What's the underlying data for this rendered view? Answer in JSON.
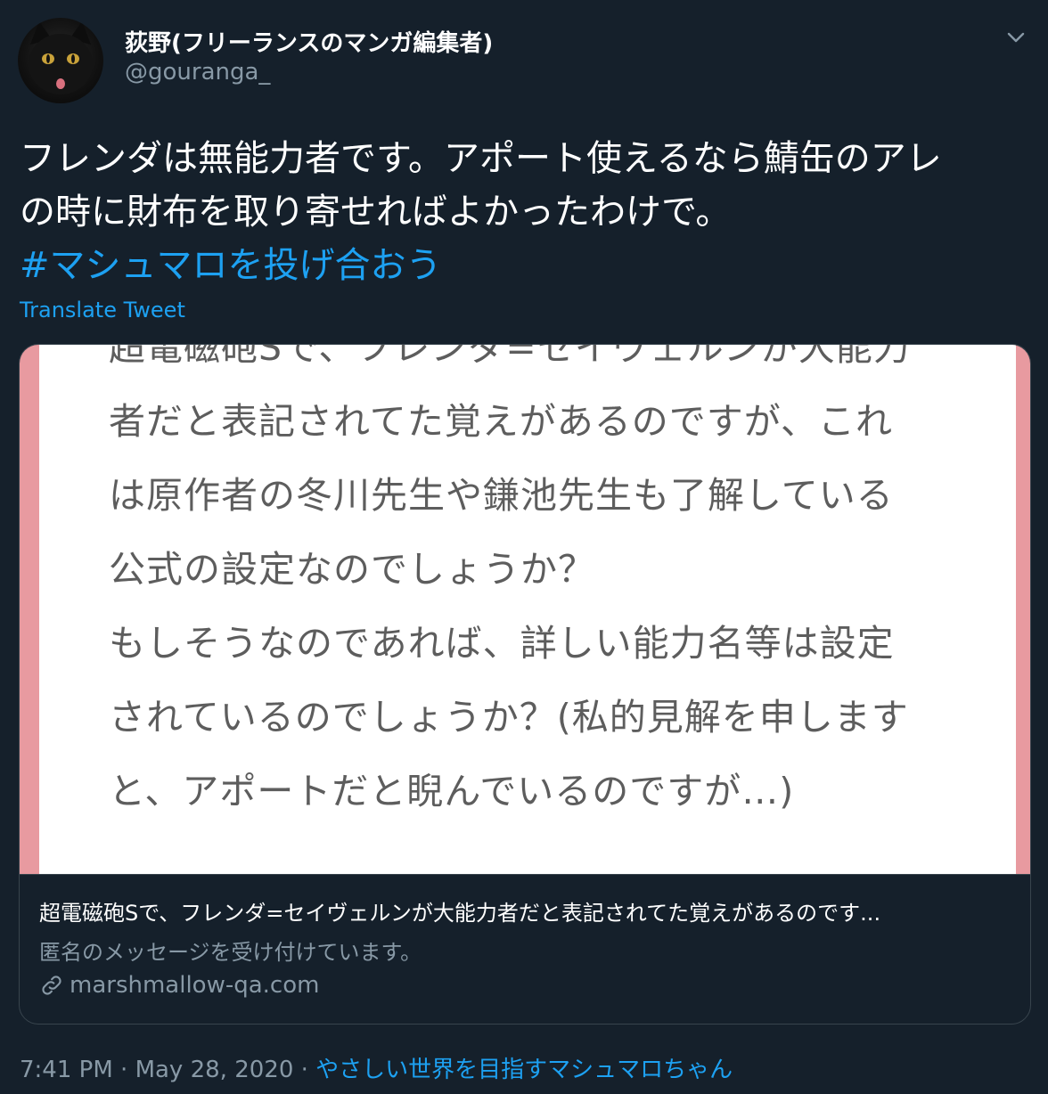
{
  "author": {
    "display_name": "荻野(フリーランスのマンガ編集者)",
    "handle": "@gouranga_"
  },
  "tweet": {
    "lines": [
      "フレンダは無能力者です。アポート使えるなら鯖缶のアレ",
      "の時に財布を取り寄せればよかったわけで。"
    ],
    "hashtag": "#マシュマロを投げ合おう",
    "translate_label": "Translate Tweet"
  },
  "card": {
    "image_text_lines": [
      "超電磁砲Sで、フレンダ=セイヴェルンが大能力",
      "者だと表記されてた覚えがあるのですが、これ",
      "は原作者の冬川先生や鎌池先生も了解している",
      "公式の設定なのでしょうか？",
      "もしそうなのであれば、詳しい能力名等は設定",
      "されているのでしょうか？(私的見解を申します",
      "と、アポートだと睨んでいるのですが…)"
    ],
    "title": "超電磁砲Sで、フレンダ=セイヴェルンが大能力者だと表記されてた覚えがあるのです...",
    "description": "匿名のメッセージを受け付けています。",
    "domain": "marshmallow-qa.com"
  },
  "meta": {
    "time": "7:41 PM",
    "separator": "·",
    "date": "May 28, 2020",
    "source": "やさしい世界を目指すマシュマロちゃん"
  },
  "colors": {
    "background": "#15202b",
    "accent": "#1da1f2",
    "secondary_text": "#8899a6",
    "card_border": "#38444d",
    "card_frame": "#e89aa0"
  },
  "icons": {
    "menu": "chevron-down-icon",
    "link": "link-icon"
  }
}
